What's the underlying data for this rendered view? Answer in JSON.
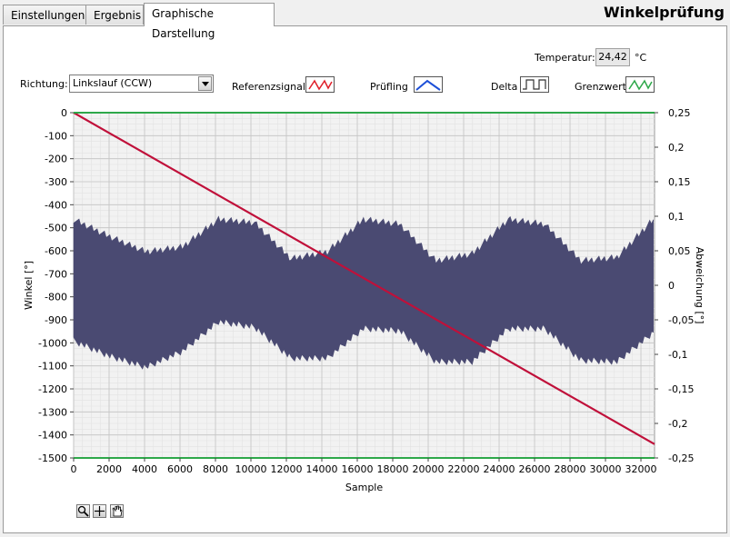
{
  "tabs": [
    {
      "label": "Einstellungen",
      "active": false
    },
    {
      "label": "Ergebnis",
      "active": false
    },
    {
      "label": "Graphische Darstellung",
      "active": true
    }
  ],
  "window_title": "Winkelprüfung",
  "temperature": {
    "label": "Temperatur:",
    "value": "24,42",
    "unit": "°C"
  },
  "direction": {
    "label": "Richtung:",
    "value": "Linkslauf (CCW)"
  },
  "legend": [
    {
      "label": "Referenzsignal",
      "icon": "red-wave-icon",
      "color": "#e0202a"
    },
    {
      "label": "Prüfling",
      "icon": "blue-triangle-icon",
      "color": "#1c4fd8"
    },
    {
      "label": "Delta",
      "icon": "square-wave-icon",
      "color": "#333333"
    },
    {
      "label": "Grenzwert",
      "icon": "green-wave-icon",
      "color": "#2ea84a"
    }
  ],
  "chart_data": {
    "type": "line",
    "xlabel": "Sample",
    "ylabel": "Winkel [°]",
    "y2label": "Abweichung [°]",
    "xlim": [
      0,
      32768
    ],
    "ylim": [
      -1500,
      0
    ],
    "y2lim": [
      -0.25,
      0.25
    ],
    "xticks": [
      "0",
      "2000",
      "4000",
      "6000",
      "8000",
      "10000",
      "12000",
      "14000",
      "16000",
      "18000",
      "20000",
      "22000",
      "24000",
      "26000",
      "28000",
      "30000",
      "32000"
    ],
    "yticks": [
      "0",
      "-100",
      "-200",
      "-300",
      "-400",
      "-500",
      "-600",
      "-700",
      "-800",
      "-900",
      "-1000",
      "-1100",
      "-1200",
      "-1300",
      "-1400",
      "-1500"
    ],
    "y2ticks": [
      "0,25",
      "0,2",
      "0,15",
      "0,1",
      "0,05",
      "0",
      "-0,05",
      "-0,1",
      "-0,15",
      "-0,2",
      "-0,25"
    ],
    "grid": true,
    "series": [
      {
        "name": "Referenzsignal",
        "x": [
          0,
          32768
        ],
        "y": [
          0,
          -1440
        ],
        "color": "#c0103a"
      },
      {
        "name": "Grenzwert",
        "x": [
          0,
          32768
        ],
        "y2": [
          0.25,
          0.25
        ],
        "color": "#2ea84a"
      },
      {
        "name": "Grenzwert",
        "x": [
          0,
          32768
        ],
        "y2": [
          -0.25,
          -0.25
        ],
        "color": "#2ea84a"
      },
      {
        "name": "Delta",
        "band": true,
        "color": "#4a4a72",
        "center_y2": [
          0.008,
          0.0075,
          0.0075,
          0.008,
          0.01,
          0.01,
          0.012,
          0.008,
          0.0075,
          0.006,
          0.008,
          0.007,
          0.008,
          0.007,
          0.006,
          0.007,
          0.008
        ],
        "upper_y2": [
          0.095,
          0.07,
          0.048,
          0.055,
          0.095,
          0.09,
          0.038,
          0.048,
          0.095,
          0.088,
          0.035,
          0.045,
          0.095,
          0.088,
          0.035,
          0.04,
          0.095
        ],
        "lower_y2": [
          -0.08,
          -0.102,
          -0.118,
          -0.095,
          -0.052,
          -0.06,
          -0.105,
          -0.105,
          -0.062,
          -0.065,
          -0.11,
          -0.11,
          -0.062,
          -0.062,
          -0.108,
          -0.11,
          -0.068
        ]
      }
    ]
  },
  "tools": [
    "zoom-icon",
    "crosshair-icon",
    "hand-icon"
  ]
}
